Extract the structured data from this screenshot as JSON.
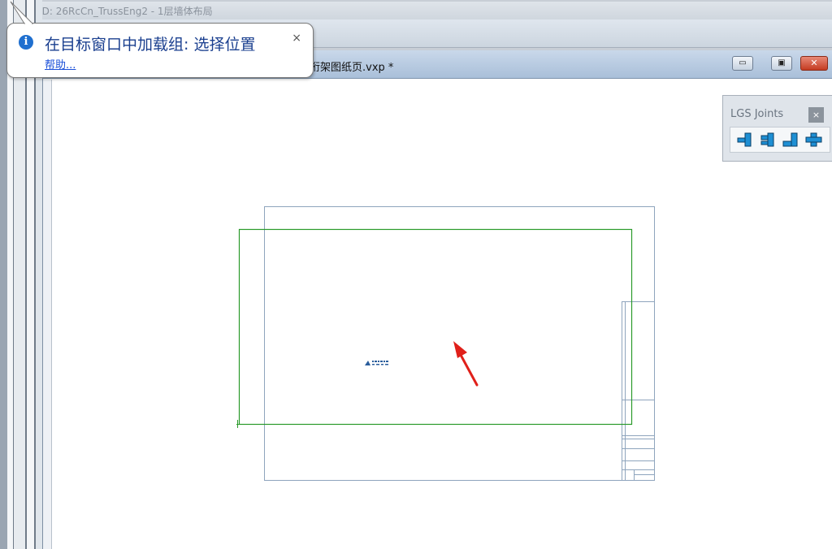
{
  "background_window": {
    "title": "3D: 26RcCn_TrussEng2 - 1层墙体布局"
  },
  "mdi_window": {
    "title": "桁架图纸页.vxp *",
    "buttons": {
      "minimize_glyph": "▭",
      "restore_glyph": "▣",
      "close_glyph": "✕"
    }
  },
  "balloon": {
    "message": "在目标窗口中加载组: 选择位置",
    "help_link": "帮助...",
    "close_glyph": "×",
    "icon": "info-icon"
  },
  "palette": {
    "title": "LGS Joints",
    "close_glyph": "×",
    "tools": [
      {
        "icon": "tee-joint-left-icon"
      },
      {
        "icon": "tee-joint-right-icon"
      },
      {
        "icon": "corner-joint-icon"
      },
      {
        "icon": "cross-joint-icon"
      }
    ]
  },
  "colors": {
    "sheet_border": "#8ea4bd",
    "placement_rect": "#2a9a2a",
    "arrow": "#e0201a",
    "tool_fill": "#1e8fd4"
  }
}
